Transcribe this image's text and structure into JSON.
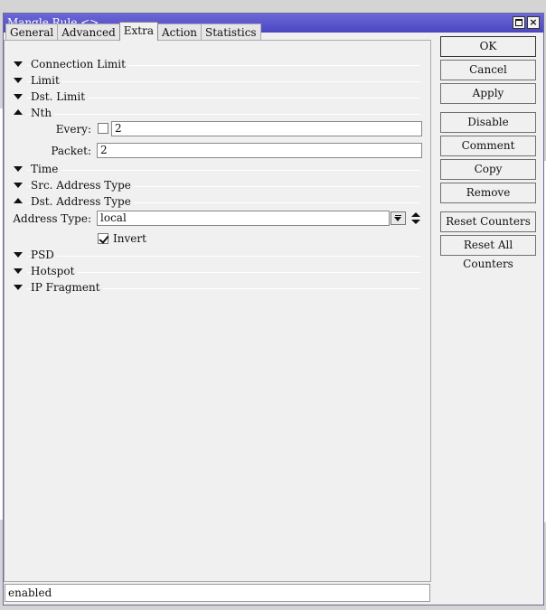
{
  "window": {
    "title": "Mangle Rule <>",
    "maximize_label": "",
    "close_label": "×"
  },
  "tabs": [
    {
      "label": "General"
    },
    {
      "label": "Advanced"
    },
    {
      "label": "Extra",
      "active": true
    },
    {
      "label": "Action"
    },
    {
      "label": "Statistics"
    }
  ],
  "sections": {
    "connection_limit": "Connection Limit",
    "limit": "Limit",
    "dst_limit": "Dst. Limit",
    "nth": "Nth",
    "time": "Time",
    "src_address_type": "Src. Address Type",
    "dst_address_type": "Dst. Address Type",
    "psd": "PSD",
    "hotspot": "Hotspot",
    "ip_fragment": "IP Fragment"
  },
  "nth": {
    "every_label": "Every:",
    "every_value": "2",
    "every_checked": false,
    "packet_label": "Packet:",
    "packet_value": "2"
  },
  "dst_address_type": {
    "address_type_label": "Address Type:",
    "address_type_value": "local",
    "invert_label": "Invert",
    "invert_checked": true
  },
  "buttons": {
    "ok": "OK",
    "cancel": "Cancel",
    "apply": "Apply",
    "disable": "Disable",
    "comment": "Comment",
    "copy": "Copy",
    "remove": "Remove",
    "reset_counters": "Reset Counters",
    "reset_all_counters": "Reset All Counters"
  },
  "status": {
    "text": "enabled"
  }
}
